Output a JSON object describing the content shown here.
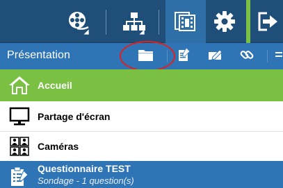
{
  "toolbar": {
    "buttons": [
      {
        "icon": "film-reel-icon",
        "has_dropdown": true
      },
      {
        "icon": "network-icon",
        "has_dropdown": true
      },
      {
        "icon": "documents-film-icon",
        "active": true
      },
      {
        "icon": "gear-icon"
      },
      {
        "icon": "exit-icon"
      }
    ],
    "colors": {
      "bar": "#1f4e79",
      "active": "#2e6fa7",
      "accent": "#7ac143"
    }
  },
  "presentation": {
    "title": "Présentation",
    "actions": [
      "folder-icon",
      "edit-list-icon",
      "pencil-icon",
      "link-icon",
      "more-icon"
    ],
    "highlighted_action": "folder-icon"
  },
  "list": {
    "home": {
      "label": "Accueil",
      "icon": "home-icon"
    },
    "screen_share": {
      "label": "Partage d'écran",
      "icon": "monitor-icon"
    },
    "cameras": {
      "label": "Caméras",
      "icon": "cameras-icon"
    },
    "questionnaire": {
      "title": "Questionnaire TEST",
      "subtitle": "Sondage - 1 question(s)",
      "icon": "survey-icon"
    }
  }
}
